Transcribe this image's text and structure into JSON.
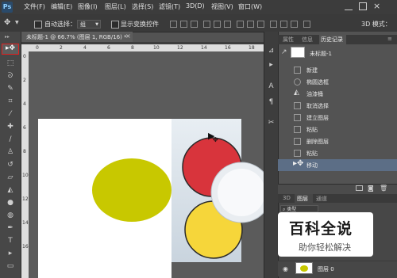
{
  "app": {
    "logo": "Ps"
  },
  "menu": [
    "文件(F)",
    "编辑(E)",
    "图像(I)",
    "图层(L)",
    "选择(S)",
    "滤镜(T)",
    "3D(D)",
    "视图(V)",
    "窗口(W)"
  ],
  "options": {
    "auto_select_label": "自动选择：",
    "auto_select_value": "组",
    "show_transform_label": "显示变换控件",
    "mode_3d_label": "3D 模式："
  },
  "document": {
    "tab_label": "未标题-1 @ 66.7% (图层 1, RGB/16) *",
    "ruler_top_numbers": [
      "0",
      "2",
      "4",
      "6",
      "8",
      "10",
      "12",
      "14",
      "16",
      "18"
    ],
    "ruler_left_numbers": [
      "0",
      "2",
      "4",
      "6",
      "8",
      "10",
      "12",
      "14",
      "16"
    ]
  },
  "history_panel": {
    "tabs": [
      "属性",
      "信息",
      "历史记录"
    ],
    "active_tab": "历史记录",
    "snapshot_label": "未标题-1",
    "items": [
      "新建",
      "椭圆选框",
      "油漆桶",
      "取消选择",
      "建立图层",
      "粘贴",
      "删除图层",
      "粘贴",
      "移动"
    ]
  },
  "layers_panel": {
    "tabs": [
      "3D",
      "图层",
      "通道"
    ],
    "active_tab": "图层",
    "filter_label": "类型",
    "layer_name": "图层 0"
  },
  "watermark": {
    "title": "百科全说",
    "subtitle": "助你轻松解决"
  },
  "colors": {
    "ellipse_olive": "#c8c800",
    "red_circle": "#d8343c",
    "yellow_circle": "#f6d63a",
    "selected_history_row": "#5c6e86",
    "highlight_red": "#e02020"
  },
  "icons": {
    "move_tool": "move-icon",
    "eye": "eye-icon"
  }
}
